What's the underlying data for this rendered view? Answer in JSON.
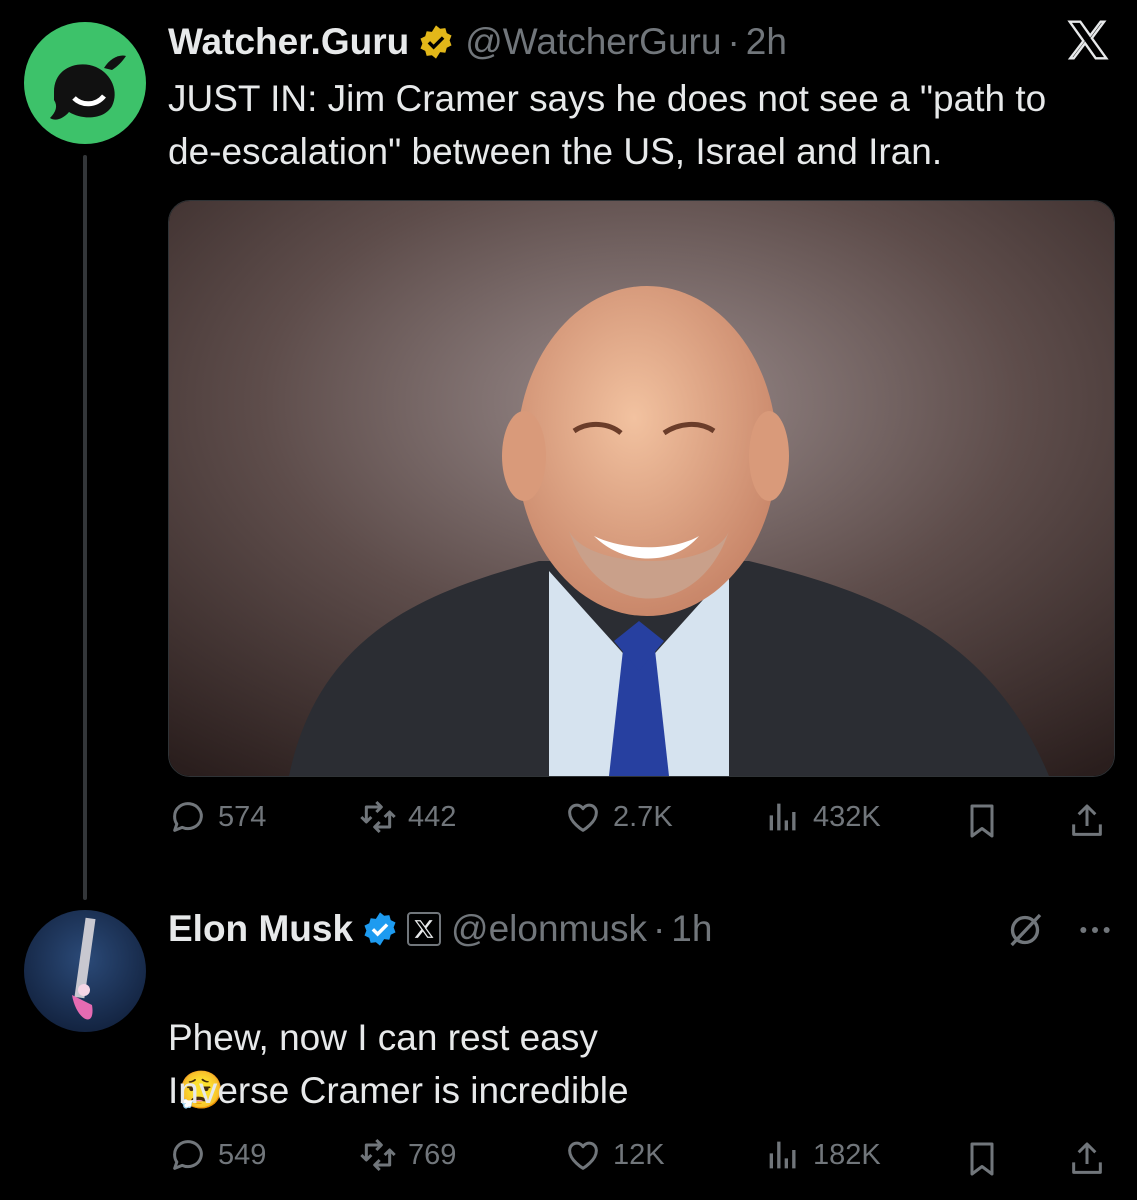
{
  "tweet1": {
    "name": "Watcher.Guru",
    "handle": "@WatcherGuru",
    "dot": "·",
    "time": "2h",
    "text": "JUST IN: Jim Cramer says he does not see a \"path to de-escalation\" between the US, Israel and Iran.",
    "actions": {
      "replies": "574",
      "reposts": "442",
      "likes": "2.7K",
      "views": "432K"
    }
  },
  "tweet2": {
    "name": "Elon Musk",
    "handle": "@elonmusk",
    "dot": "·",
    "time": "1h",
    "text_line1": "Phew, now I can rest easy",
    "emoji": "😮‍💨",
    "text_line2": "Inverse Cramer is incredible",
    "actions": {
      "replies": "549",
      "reposts": "769",
      "likes": "12K",
      "views": "182K"
    }
  },
  "icons": {
    "reply": "reply-icon",
    "repost": "repost-icon",
    "like": "heart-icon",
    "views": "views-icon",
    "bookmark": "bookmark-icon",
    "share": "share-icon",
    "x_logo": "x-logo-icon",
    "grok": "grok-icon",
    "more": "more-icon"
  },
  "colors": {
    "background": "#000000",
    "text": "#e7e9ea",
    "muted": "#71767b",
    "watcher_green": "#3dc26a",
    "gold_badge": "#e2b719",
    "blue_badge": "#1d9bf0"
  }
}
